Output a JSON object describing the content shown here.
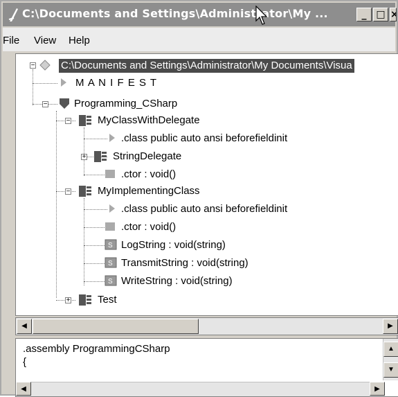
{
  "window": {
    "title": "C:\\Documents and Settings\\Administrator\\My ...",
    "minimize_label": "_",
    "maximize_label": "□",
    "close_label": "×"
  },
  "menu": {
    "items": [
      "File",
      "View",
      "Help"
    ]
  },
  "tree": {
    "root": "C:\\Documents and Settings\\Administrator\\My Documents\\Visua",
    "manifest": "M A N I F E S T",
    "namespace": "Programming_CSharp",
    "class1": {
      "name": "MyClassWithDelegate",
      "decl": ".class public auto ansi beforefieldinit",
      "delegate": "StringDelegate",
      "ctor": ".ctor : void()"
    },
    "class2": {
      "name": "MyImplementingClass",
      "decl": ".class public auto ansi beforefieldinit",
      "ctor": ".ctor : void()",
      "m1": "LogString : void(string)",
      "m2": "TransmitString : void(string)",
      "m3": "WriteString : void(string)"
    },
    "test": "Test"
  },
  "il": {
    "line1": ".assembly ProgrammingCSharp",
    "line2": "{"
  },
  "colors": {
    "titlebar": "#8e8e8e",
    "selection": "#4a4a4a"
  }
}
